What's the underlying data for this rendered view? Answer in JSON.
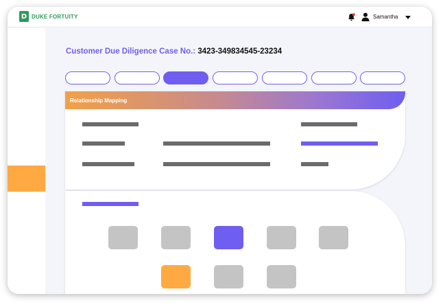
{
  "brand": {
    "logo_mark": "D",
    "name": "DUKE FORTUITY",
    "color": "#2e9a5a"
  },
  "header": {
    "notification_icon": "bell-icon",
    "user_icon": "user-icon",
    "user_name": "Samantha",
    "menu_icon": "caret-down-icon"
  },
  "case": {
    "label": "Customer Due Diligence Case No.:",
    "number": "3423-349834545-23234"
  },
  "stepper": {
    "count": 7,
    "active_index": 2
  },
  "relationship_section": {
    "title": "Relationship Mapping"
  },
  "tiles": {
    "row1": [
      "gray",
      "gray",
      "purple",
      "gray",
      "gray"
    ],
    "row2": [
      "orange",
      "gray",
      "gray"
    ]
  },
  "colors": {
    "accent_purple": "#6f5ef0",
    "accent_orange": "#ffa943",
    "placeholder_gray": "#6b6b6b",
    "tile_gray": "#c4c4c4"
  }
}
